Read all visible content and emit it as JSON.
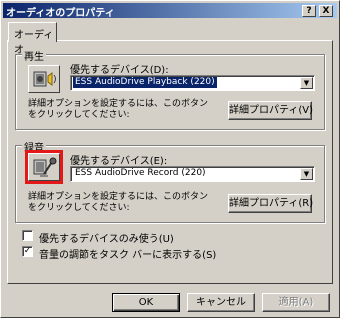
{
  "window": {
    "title": "オーディオのプロパティ",
    "help_btn": "?",
    "close_btn": "X"
  },
  "tabs": [
    {
      "label": "オーディオ",
      "active": true
    }
  ],
  "playback": {
    "group_label": "再生",
    "device_label": "優先するデバイス(D):",
    "device_value": "ESS AudioDrive Playback (220)",
    "description": "詳細オプションを設定するには、このボタンをクリックしてください:",
    "advanced_button": "詳細プロパティ(V)"
  },
  "recording": {
    "group_label": "録音",
    "device_label": "優先するデバイス(E):",
    "device_value": "ESS AudioDrive Record (220)",
    "description": "詳細オプションを設定するには、このボタンをクリックしてください:",
    "advanced_button": "詳細プロパティ(R)"
  },
  "options": [
    {
      "label": "優先するデバイスのみ使う(U)",
      "checked": false
    },
    {
      "label": "音量の調節をタスク バーに表示する(S)",
      "checked": true
    }
  ],
  "footer": {
    "ok": "OK",
    "cancel": "キャンセル",
    "apply": "適用(A)"
  },
  "colors": {
    "highlight": "#0a246a",
    "selection_frame": "#e31818"
  }
}
